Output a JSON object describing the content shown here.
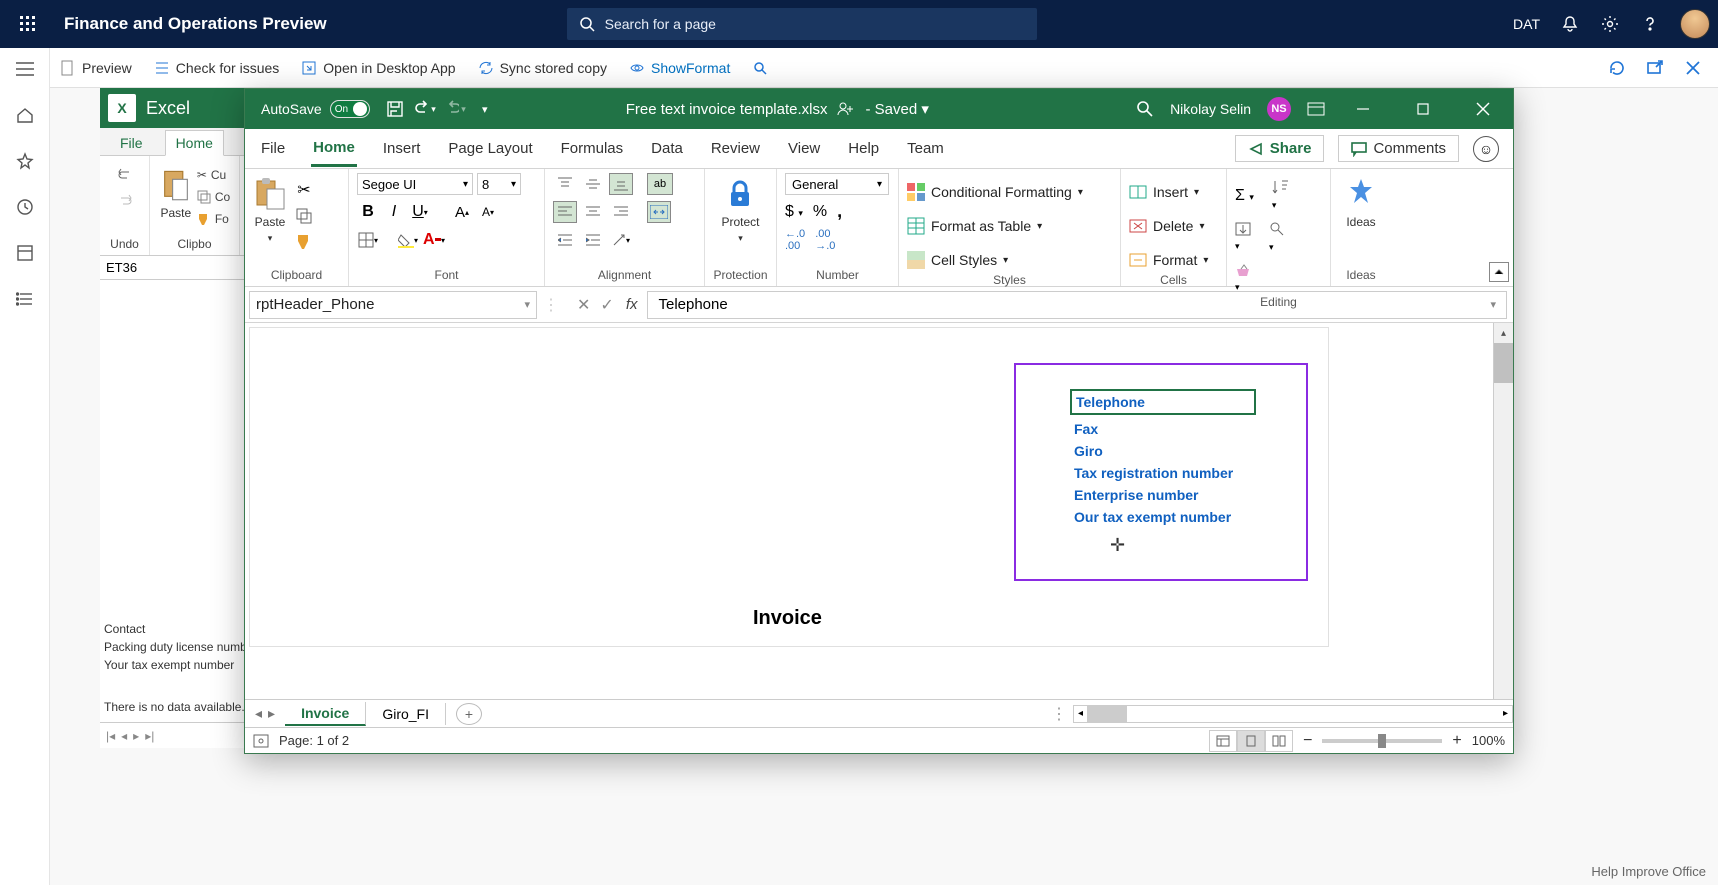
{
  "header": {
    "title": "Finance and Operations Preview",
    "search_placeholder": "Search for a page",
    "company": "DAT"
  },
  "fo_toolbar": {
    "preview": "Preview",
    "check": "Check for issues",
    "open_desktop": "Open in Desktop App",
    "sync": "Sync stored copy",
    "show_format": "ShowFormat"
  },
  "excel_online": {
    "brand": "Excel",
    "tab_file": "File",
    "tab_home": "Home",
    "undo": "Undo",
    "clipboard": "Clipbo",
    "paste": "Paste",
    "cu": "Cu",
    "co": "Co",
    "fo": "Fo",
    "cell_ref": "ET36",
    "contact": "Contact",
    "packing": "Packing duty license number",
    "tax_exempt": "Your tax exempt number",
    "no_data": "There is no data available."
  },
  "excel": {
    "autosave": "AutoSave",
    "autosave_state": "On",
    "doc_title": "Free text invoice template.xlsx",
    "saved": "Saved",
    "user_name": "Nikolay Selin",
    "user_initials": "NS",
    "tabs": {
      "file": "File",
      "home": "Home",
      "insert": "Insert",
      "page_layout": "Page Layout",
      "formulas": "Formulas",
      "data": "Data",
      "review": "Review",
      "view": "View",
      "help": "Help",
      "team": "Team"
    },
    "share": "Share",
    "comments": "Comments",
    "ribbon": {
      "paste": "Paste",
      "clipboard": "Clipboard",
      "font_name": "Segoe UI",
      "font_size": "8",
      "font": "Font",
      "alignment": "Alignment",
      "protect": "Protect",
      "protection": "Protection",
      "num_format": "General",
      "number": "Number",
      "cond_fmt": "Conditional Formatting",
      "fmt_table": "Format as Table",
      "cell_styles": "Cell Styles",
      "styles": "Styles",
      "insert": "Insert",
      "delete": "Delete",
      "format": "Format",
      "cells": "Cells",
      "editing": "Editing",
      "ideas": "Ideas"
    },
    "namebox": "rptHeader_Phone",
    "formula": "Telephone",
    "sheet": {
      "fields": [
        "Telephone",
        "Fax",
        "Giro",
        "Tax registration number",
        "Enterprise number",
        "Our tax exempt number"
      ],
      "invoice": "Invoice"
    },
    "tabs_bottom": {
      "invoice": "Invoice",
      "giro": "Giro_FI"
    },
    "status": {
      "page": "Page: 1 of 2",
      "zoom": "100%"
    }
  },
  "footer": {
    "help": "Help Improve Office"
  }
}
